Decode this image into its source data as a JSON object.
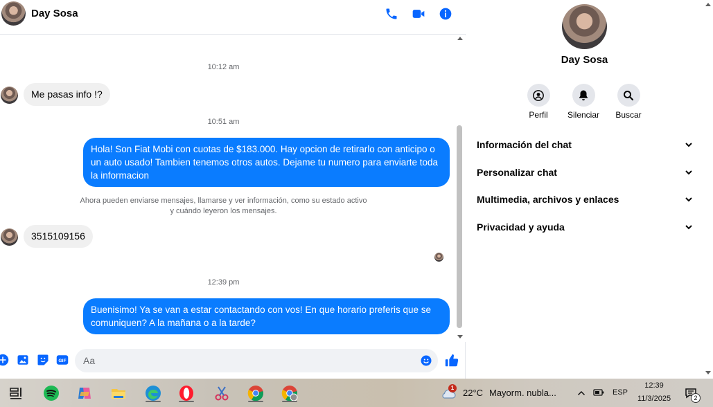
{
  "header": {
    "contact_name": "Day Sosa"
  },
  "messages": [
    {
      "type": "timestamp",
      "text": "10:12 am"
    },
    {
      "type": "incoming",
      "text": "Me pasas info !?"
    },
    {
      "type": "timestamp",
      "text": "10:51 am"
    },
    {
      "type": "outgoing",
      "text": "Hola! Son Fiat Mobi con cuotas de $183.000. Hay opcion de retirarlo con anticipo o un auto usado! Tambien tenemos otros autos. Dejame tu numero para enviarte toda la informacion"
    },
    {
      "type": "system",
      "line1": "Ahora pueden enviarse mensajes, llamarse y ver información, como su estado activo",
      "line2": "y cuándo leyeron los mensajes."
    },
    {
      "type": "incoming",
      "text": "3515109156"
    },
    {
      "type": "timestamp",
      "text": "12:39 pm"
    },
    {
      "type": "outgoing",
      "text": "Buenisimo! Ya se van a estar contactando con vos! En que horario preferis que se comuniquen? A la mañana o a la tarde?"
    }
  ],
  "composer": {
    "placeholder": "Aa"
  },
  "info_panel": {
    "name": "Day Sosa",
    "actions": [
      {
        "label": "Perfil",
        "icon": "profile-icon"
      },
      {
        "label": "Silenciar",
        "icon": "bell-icon"
      },
      {
        "label": "Buscar",
        "icon": "search-icon"
      }
    ],
    "sections": [
      "Información del chat",
      "Personalizar chat",
      "Multimedia, archivos y enlaces",
      "Privacidad y ayuda"
    ]
  },
  "taskbar": {
    "apps": [
      "task-view-icon",
      "spotify-icon",
      "copilot-icon",
      "file-explorer-icon",
      "edge-icon",
      "opera-icon",
      "snipping-tool-icon",
      "chrome-icon",
      "chrome-profile-icon"
    ],
    "weather": {
      "badge": "1",
      "temp": "22°C",
      "desc": "Mayorm. nubla..."
    },
    "language": "ESP",
    "time": "12:39",
    "date": "11/3/2025",
    "notification_count": "2"
  },
  "colors": {
    "accent": "#0a7cff",
    "messenger_blue": "#0866ff"
  }
}
